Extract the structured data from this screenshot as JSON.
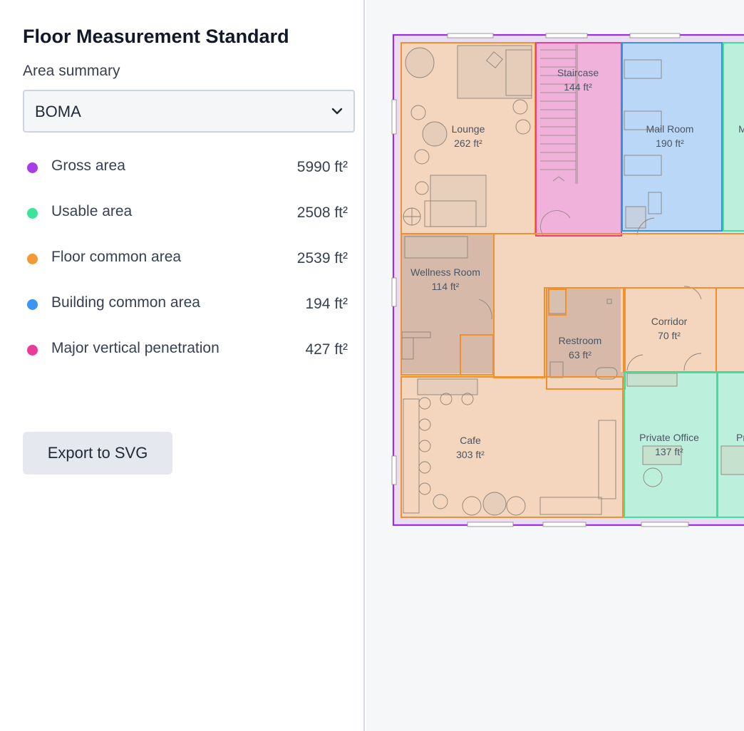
{
  "sidebar": {
    "title": "Floor Measurement Standard",
    "area_label": "Area summary",
    "select_value": "BOMA",
    "chevron_icon": "chevron-down-icon",
    "summary": [
      {
        "label": "Gross area",
        "value": "5990 ft²",
        "color": "#a63ee8"
      },
      {
        "label": "Usable area",
        "value": "2508 ft²",
        "color": "#3de39b"
      },
      {
        "label": "Floor common area",
        "value": "2539 ft²",
        "color": "#f29a38"
      },
      {
        "label": "Building common area",
        "value": "194 ft²",
        "color": "#3a96f2"
      },
      {
        "label": "Major vertical penetration",
        "value": "427 ft²",
        "color": "#eb3b98"
      }
    ],
    "export_label": "Export to SVG"
  },
  "plan": {
    "rooms": [
      {
        "name": "Lounge",
        "area": "262 ft²"
      },
      {
        "name": "Staircase",
        "area": "144 ft²"
      },
      {
        "name": "Mail Room",
        "area": "190 ft²"
      },
      {
        "name": "Wellness Room",
        "area": "114 ft²"
      },
      {
        "name": "Restroom",
        "area": "63 ft²"
      },
      {
        "name": "Corridor",
        "area": "70 ft²"
      },
      {
        "name": "Cafe",
        "area": "303 ft²"
      },
      {
        "name": "Private Office",
        "area": "137 ft²"
      }
    ],
    "clipped_labels": [
      "M",
      "Pr"
    ]
  }
}
